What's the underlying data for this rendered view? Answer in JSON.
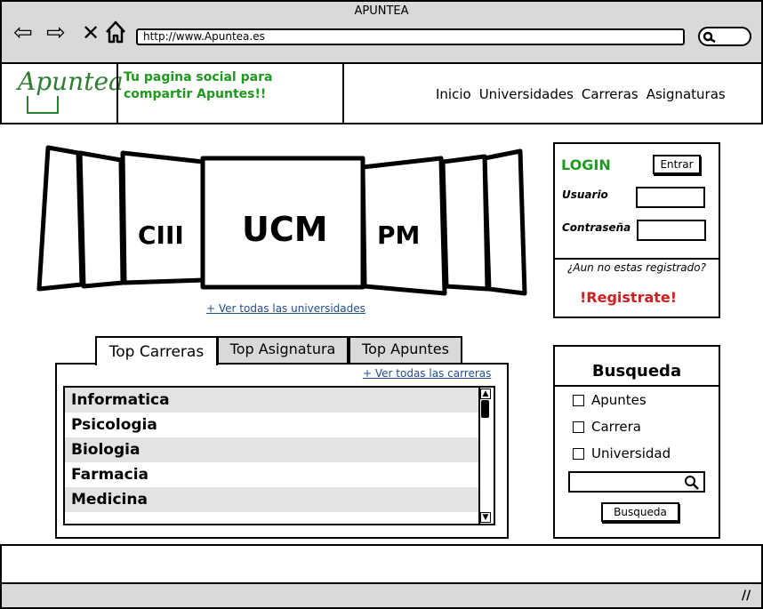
{
  "window": {
    "title": "APUNTEA",
    "url": "http://www.Apuntea.es"
  },
  "header": {
    "logo": "Apuntea",
    "tagline": "Tu pagina social para compartir Apuntes!!",
    "nav": [
      "Inicio",
      "Universidades",
      "Carreras",
      "Asignaturas"
    ]
  },
  "carousel": {
    "cards": [
      "CIII",
      "UCM",
      "PM"
    ],
    "see_all": "+ Ver todas las universidades"
  },
  "login": {
    "title": "LOGIN",
    "submit_label": "Entrar",
    "user_label": "Usuario",
    "user_value": "",
    "password_label": "Contraseña",
    "password_value": "",
    "not_registered": "¿Aun no estas registrado?",
    "register_link": "!Registrate!"
  },
  "tabs": [
    "Top Carreras",
    "Top Asignatura",
    "Top Apuntes"
  ],
  "careers": {
    "see_all": "+ Ver todas las carreras",
    "items": [
      "Informatica",
      "Psicologia",
      "Biologia",
      "Farmacia",
      "Medicina"
    ]
  },
  "search": {
    "title": "Busqueda",
    "options": [
      "Apuntes",
      "Carrera",
      "Universidad"
    ],
    "query": "",
    "button_label": "Busqueda"
  },
  "colors": {
    "accent_green": "#1f9a1f",
    "link_blue": "#1f4e8c",
    "register_red": "#cc1f1f",
    "chrome_gray": "#d9d9d9"
  }
}
